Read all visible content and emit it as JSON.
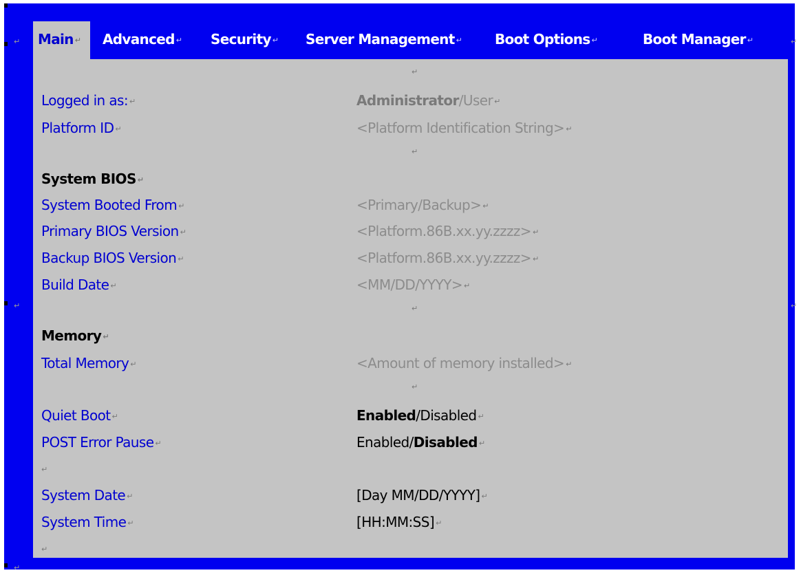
{
  "tabs": [
    {
      "label": "Main",
      "active": true
    },
    {
      "label": "Advanced",
      "active": false
    },
    {
      "label": "Security",
      "active": false
    },
    {
      "label": "Server Management",
      "active": false
    },
    {
      "label": "Boot Options",
      "active": false
    },
    {
      "label": "Boot Manager",
      "active": false
    }
  ],
  "colors": {
    "frame": "#0000f0",
    "panel": "#c4c4c4",
    "label": "#0000d0",
    "value_grey": "#8c8c8c"
  },
  "paragraph_mark": "↵",
  "main": {
    "logged_in_as": {
      "label": "Logged in as:",
      "value_bold": "Administrator",
      "value_rest": "/User"
    },
    "platform_id": {
      "label": "Platform ID",
      "value": "<Platform Identification String>"
    },
    "system_bios": {
      "heading": "System BIOS",
      "booted_from": {
        "label": "System Booted From",
        "value": "<Primary/Backup>"
      },
      "primary_version": {
        "label": "Primary BIOS Version",
        "value": "<Platform.86B.xx.yy.zzzz>"
      },
      "backup_version": {
        "label": "Backup BIOS Version",
        "value": "<Platform.86B.xx.yy.zzzz>"
      },
      "build_date": {
        "label": "Build Date",
        "value": "<MM/DD/YYYY>"
      }
    },
    "memory": {
      "heading": "Memory",
      "total": {
        "label": "Total Memory",
        "value": "<Amount of memory installed>"
      }
    },
    "quiet_boot": {
      "label": "Quiet Boot",
      "value_bold": "Enabled",
      "value_rest": "/Disabled"
    },
    "post_error_pause": {
      "label": "POST Error Pause",
      "value_rest": "Enabled/",
      "value_bold": "Disabled"
    },
    "system_date": {
      "label": "System Date",
      "value": "[Day MM/DD/YYYY]"
    },
    "system_time": {
      "label": "System Time",
      "value": "[HH:MM:SS]"
    }
  }
}
